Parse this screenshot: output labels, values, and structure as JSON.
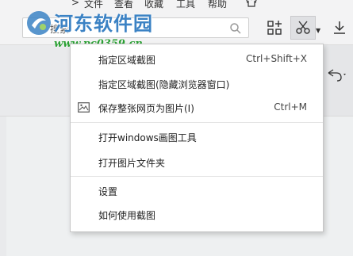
{
  "menubar": {
    "chevron": ">",
    "items": [
      "文件",
      "查看",
      "收藏",
      "工具",
      "帮助"
    ]
  },
  "search": {
    "placeholder": "",
    "value": "搜索"
  },
  "watermark": {
    "title": "河东软件园",
    "url": "www.pc0359.cn"
  },
  "context_menu": {
    "items": [
      {
        "label": "指定区域截图",
        "shortcut": "Ctrl+Shift+X"
      },
      {
        "label": "指定区域截图(隐藏浏览器窗口)",
        "shortcut": ""
      },
      {
        "label": "保存整张网页为图片(I)",
        "shortcut": "Ctrl+M"
      },
      {
        "label": "打开windows画图工具",
        "shortcut": ""
      },
      {
        "label": "打开图片文件夹",
        "shortcut": ""
      },
      {
        "label": "设置",
        "shortcut": ""
      },
      {
        "label": "如何使用截图",
        "shortcut": ""
      }
    ]
  },
  "colors": {
    "accent": "#3b82c4",
    "watermark_url": "#2aa033",
    "menu_bg": "#ffffff"
  }
}
